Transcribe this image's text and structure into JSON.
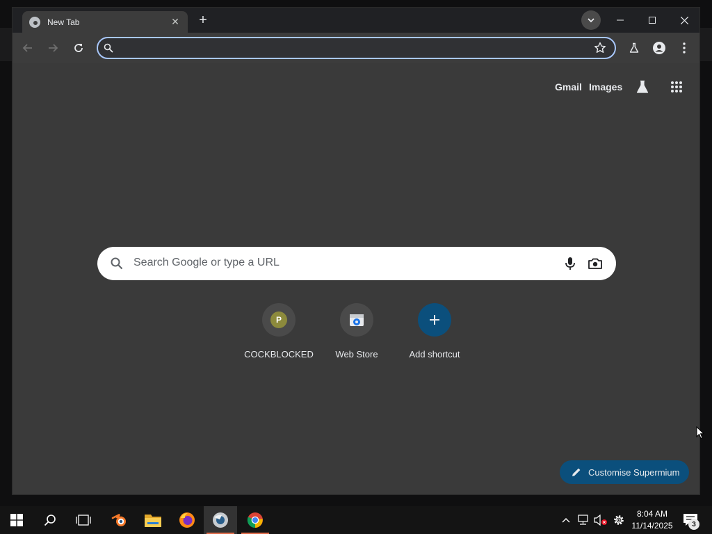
{
  "browser": {
    "tab": {
      "title": "New Tab",
      "close_glyph": "✕"
    },
    "new_tab_glyph": "+",
    "window_controls": {
      "minimize": "—",
      "maximize": "☐",
      "close": "✕"
    },
    "omnibox": {
      "value": "",
      "placeholder": ""
    }
  },
  "ntp": {
    "links": {
      "gmail": "Gmail",
      "images": "Images"
    },
    "search": {
      "placeholder": "Search Google or type a URL"
    },
    "shortcuts": [
      {
        "label": "COCKBLOCKED",
        "icon": "letter-tile",
        "letter": "P"
      },
      {
        "label": "Web Store",
        "icon": "webstore-icon"
      },
      {
        "label": "Add shortcut",
        "icon": "plus-icon",
        "glyph": "+"
      }
    ],
    "customise_label": "Customise Supermium"
  },
  "taskbar": {
    "apps": [
      "windows-start",
      "search",
      "task-view",
      "blender",
      "file-explorer",
      "firefox",
      "browser-app",
      "chrome"
    ],
    "clock": {
      "time": "8:04 AM",
      "date": "11/14/2025"
    },
    "notifications_count": "3"
  },
  "colors": {
    "accent": "#a8c7fa",
    "ntp_background": "#3a3a3a",
    "customise_button": "#0b4f7c",
    "shortcut_letter_tile": "#8c8a3c"
  }
}
